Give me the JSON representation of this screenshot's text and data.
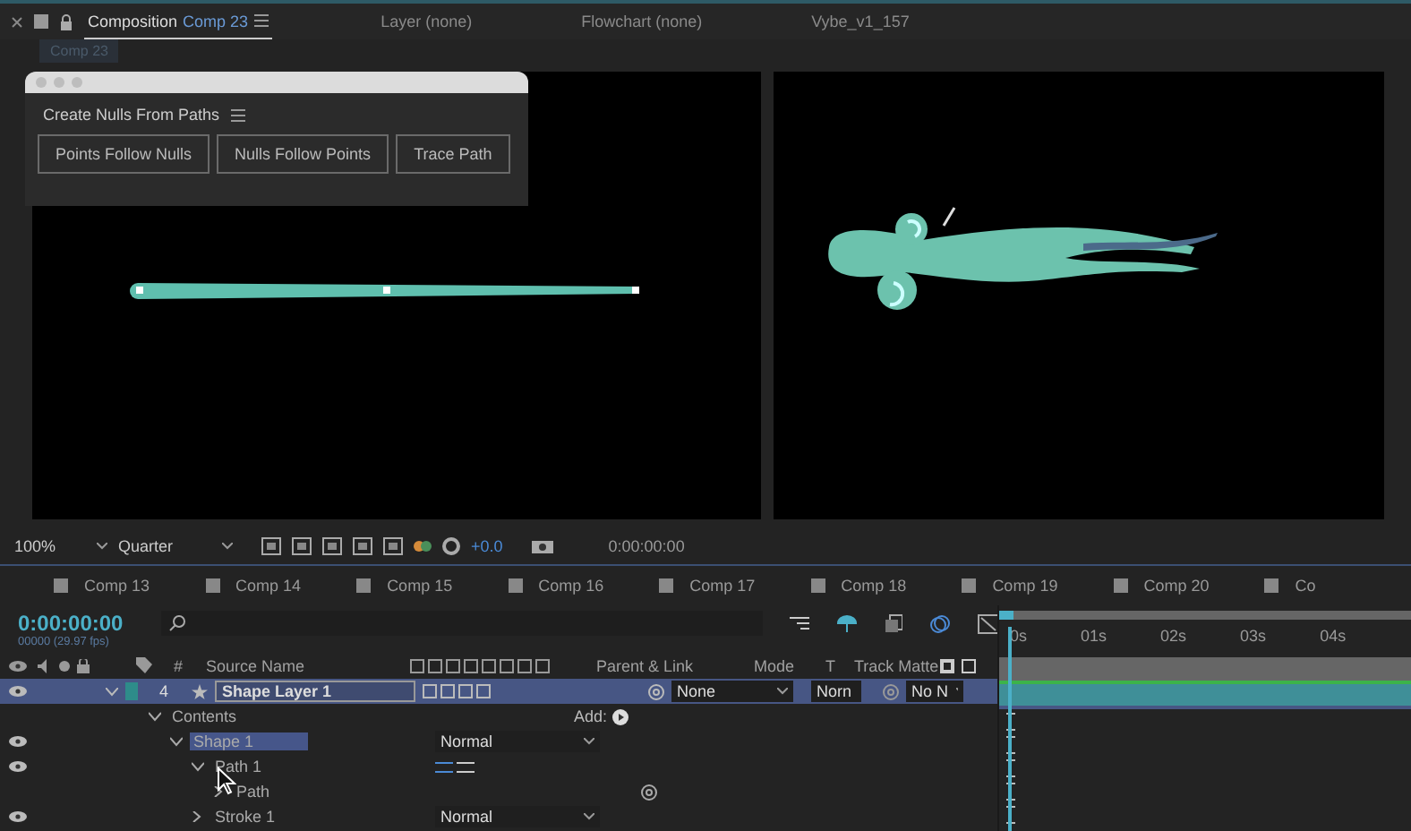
{
  "panel_tabs": [
    {
      "label": "Composition",
      "comp": "Comp 23",
      "selected": true
    },
    {
      "label": "Layer (none)",
      "selected": false
    },
    {
      "label": "Flowchart (none)",
      "selected": false
    },
    {
      "label": "Vybe_v1_157",
      "selected": false
    }
  ],
  "breadcrumb": "Comp 23",
  "script_panel": {
    "title": "Create Nulls From Paths",
    "buttons": [
      "Points Follow Nulls",
      "Nulls Follow Points",
      "Trace Path"
    ]
  },
  "viewer_toolbar": {
    "zoom": "100%",
    "resolution": "Quarter",
    "exposure": "+0.0",
    "timecode": "0:00:00:00"
  },
  "comp_tabs": [
    "Comp 13",
    "Comp 14",
    "Comp 15",
    "Comp 16",
    "Comp 17",
    "Comp 18",
    "Comp 19",
    "Comp 20",
    "Co"
  ],
  "timeline": {
    "timecode": "0:00:00:00",
    "fps": "00000 (29.97 fps)",
    "ruler": [
      "0s",
      "01s",
      "02s",
      "03s",
      "04s"
    ],
    "columns": {
      "number": "#",
      "source_name": "Source Name",
      "parent": "Parent & Link",
      "mode": "Mode",
      "t": "T",
      "track_matte": "Track Matte"
    },
    "layer": {
      "number": "4",
      "name": "Shape Layer 1",
      "selected": true,
      "expanded": true,
      "parent": "None",
      "mode": "Norn",
      "track_matte": "No N"
    },
    "properties": [
      {
        "name": "Contents",
        "expanded": true,
        "eye": false,
        "selected": false,
        "kind": "add",
        "add_label": "Add:",
        "children": [
          {
            "name": "Shape 1",
            "expanded": true,
            "eye": true,
            "selected": true,
            "kind": "blend",
            "mode": "Normal",
            "children": [
              {
                "name": "Path 1",
                "expanded": true,
                "eye": true,
                "selected": false,
                "kind": "path-direction",
                "children": [
                  {
                    "name": "Path",
                    "expanded": false,
                    "eye": false,
                    "selected": false,
                    "kind": "stopwatch"
                  }
                ]
              },
              {
                "name": "Stroke 1",
                "expanded": false,
                "eye": true,
                "selected": false,
                "kind": "blend",
                "mode": "Normal"
              }
            ]
          }
        ]
      }
    ]
  }
}
